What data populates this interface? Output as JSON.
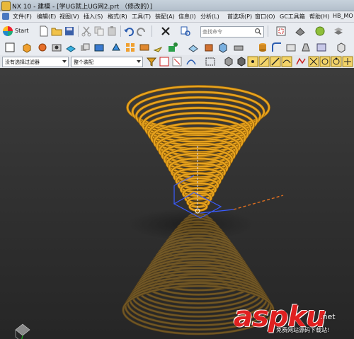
{
  "window": {
    "title": "NX 10 - 建模 - [学UG就上UG网2.prt （修改的）]"
  },
  "menu": {
    "items": [
      {
        "label": "文件(F)"
      },
      {
        "label": "编辑(E)"
      },
      {
        "label": "视图(V)"
      },
      {
        "label": "插入(S)"
      },
      {
        "label": "格式(R)"
      },
      {
        "label": "工具(T)"
      },
      {
        "label": "装配(A)"
      },
      {
        "label": "信息(I)"
      },
      {
        "label": "分析(L)"
      },
      {
        "label": "首选项(P)"
      },
      {
        "label": "窗口(O)"
      },
      {
        "label": "GC工具箱"
      },
      {
        "label": "帮助(H)"
      },
      {
        "label": "HB_MO"
      }
    ]
  },
  "toolbar": {
    "start_label": "Start",
    "search_placeholder": "查找命令"
  },
  "selection_bar": {
    "filter_value": "没有选择过滤器",
    "scope_value": "整个装配"
  },
  "watermark": {
    "brand": "aspku",
    "brand_suffix": ".net",
    "tagline": "免费网站源码下载站!"
  },
  "colors": {
    "spring": "#e6a21e",
    "spring_dark": "#8a5a08",
    "viewport_bg": "#303030",
    "watermark_red": "#e02020"
  }
}
